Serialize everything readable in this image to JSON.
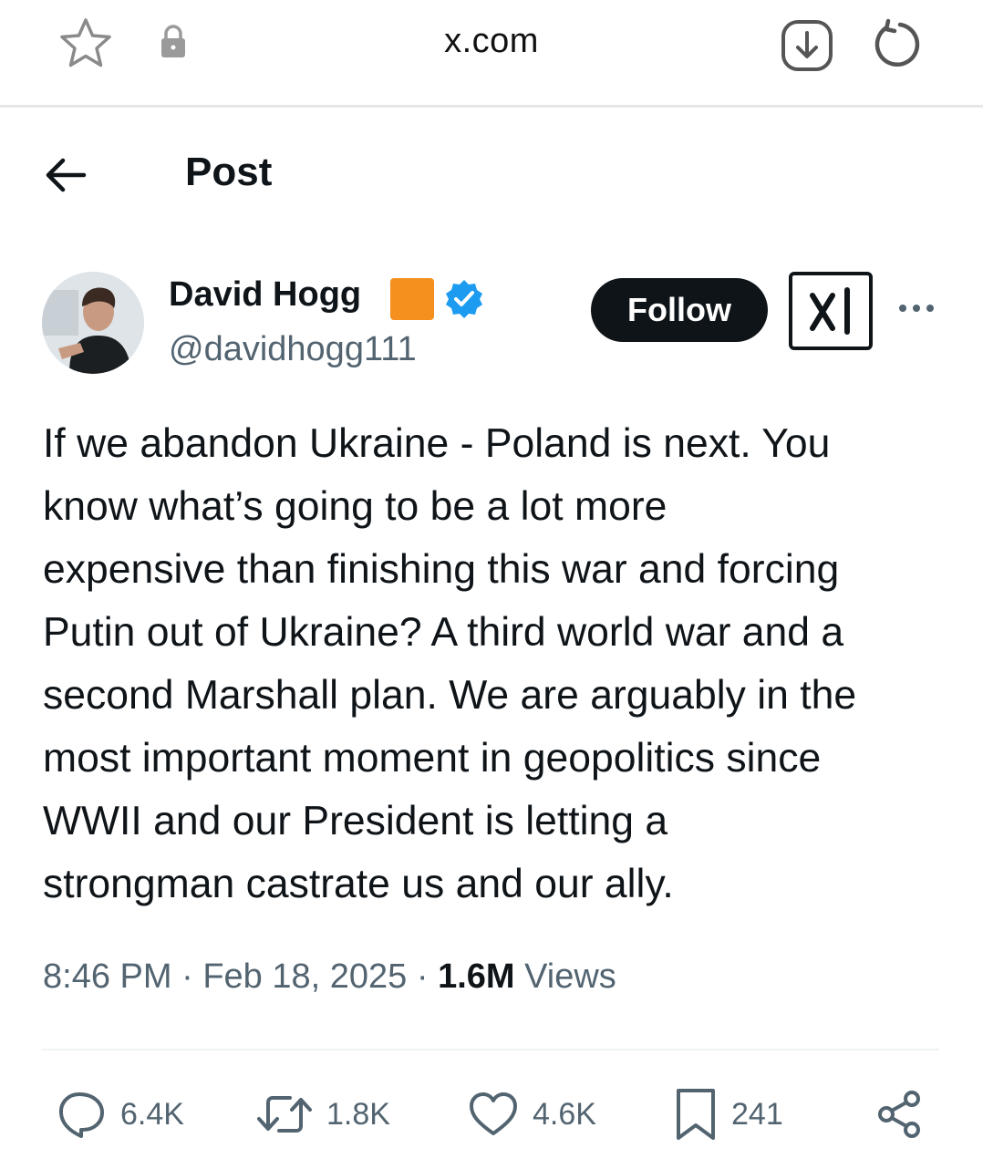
{
  "browser": {
    "url": "x.com",
    "icons": [
      "star-icon",
      "lock-icon",
      "download-icon",
      "reload-icon"
    ]
  },
  "header": {
    "back_icon": "arrow-left-icon",
    "title": "Post"
  },
  "author": {
    "name": "David Hogg",
    "handle": "@davidhogg111",
    "affiliation_badge_color": "#f5901e",
    "verified_color": "#1d9bf0"
  },
  "actions_top": {
    "follow_label": "Follow",
    "grok_icon": "grok-icon",
    "more_icon": "more-dots-icon"
  },
  "post": {
    "text": "If we abandon Ukraine - Poland is next. You\nknow what’s going to be a lot more\nexpensive than finishing this war and forcing\nPutin out of Ukraine? A third world war and a\nsecond Marshall plan. We are arguably in the\nmost important moment in geopolitics since\nWWII and our President is letting a\nstrongman castrate us and our ally.",
    "time": "8:46 PM",
    "separator": " · ",
    "date": "Feb 18, 2025",
    "views_count": "1.6M",
    "views_label": "Views"
  },
  "engagement": {
    "replies": "6.4K",
    "reposts": "1.8K",
    "likes": "4.6K",
    "bookmarks": "241"
  },
  "colors": {
    "text": "#0f1419",
    "secondary": "#536471",
    "follow_bg": "#0f1419"
  }
}
